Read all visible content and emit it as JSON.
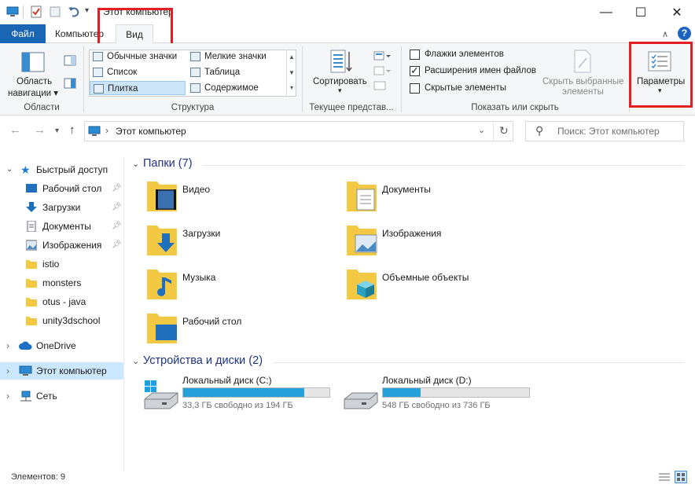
{
  "window": {
    "title": "Этот компьютер",
    "controls": {
      "minimize": "—",
      "maximize": "☐",
      "close": "✕"
    }
  },
  "ribbon_tabs": [
    {
      "label": "Файл",
      "active": false
    },
    {
      "label": "Компьютер",
      "active": false
    },
    {
      "label": "Вид",
      "active": true
    }
  ],
  "ribbon": {
    "panes": {
      "nav_pane_label_1": "Область",
      "nav_pane_label_2": "навигации",
      "group_label": "Области"
    },
    "layout": {
      "items": [
        "Обычные значки",
        "Мелкие значки",
        "Список",
        "Таблица",
        "Плитка",
        "Содержимое"
      ],
      "selected": "Плитка",
      "group_label": "Структура"
    },
    "current_view": {
      "sort_label": "Сортировать",
      "group_label": "Текущее представ..."
    },
    "show_hide": {
      "checkboxes": [
        {
          "label": "Флажки элементов",
          "checked": false
        },
        {
          "label": "Расширения имен файлов",
          "checked": true
        },
        {
          "label": "Скрытые элементы",
          "checked": false
        }
      ],
      "hide_selected_1": "Скрыть выбранные",
      "hide_selected_2": "элементы",
      "group_label": "Показать или скрыть"
    },
    "options_label": "Параметры"
  },
  "address": {
    "path": "Этот компьютер",
    "separator": "›",
    "search_placeholder": "Поиск: Этот компьютер"
  },
  "sidebar": {
    "quick_access": "Быстрый доступ",
    "quick_items": [
      {
        "label": "Рабочий стол",
        "pinned": true
      },
      {
        "label": "Загрузки",
        "pinned": true
      },
      {
        "label": "Документы",
        "pinned": true
      },
      {
        "label": "Изображения",
        "pinned": true
      },
      {
        "label": "istio",
        "pinned": false
      },
      {
        "label": "monsters",
        "pinned": false
      },
      {
        "label": "otus - java",
        "pinned": false
      },
      {
        "label": "unity3dschool",
        "pinned": false
      }
    ],
    "onedrive": "OneDrive",
    "this_pc": "Этот компьютер",
    "network": "Сеть"
  },
  "content": {
    "folders_header": "Папки (7)",
    "folders": [
      "Видео",
      "Документы",
      "Загрузки",
      "Изображения",
      "Музыка",
      "Объемные объекты",
      "Рабочий стол"
    ],
    "devices_header": "Устройства и диски (2)",
    "drives": [
      {
        "name": "Локальный диск (C:)",
        "free": "33,3 ГБ свободно из 194 ГБ",
        "used_fraction": 0.83
      },
      {
        "name": "Локальный диск (D:)",
        "free": "548 ГБ свободно из 736 ГБ",
        "used_fraction": 0.26
      }
    ]
  },
  "status": {
    "items_count": "Элементов: 9"
  },
  "colors": {
    "file_tab": "#1a66b3",
    "accent_blue": "#26a0da",
    "highlight_red": "#e31e24",
    "section_header": "#1e3287",
    "selection": "#cce8ff",
    "folder_yellow": "#f3c843"
  }
}
